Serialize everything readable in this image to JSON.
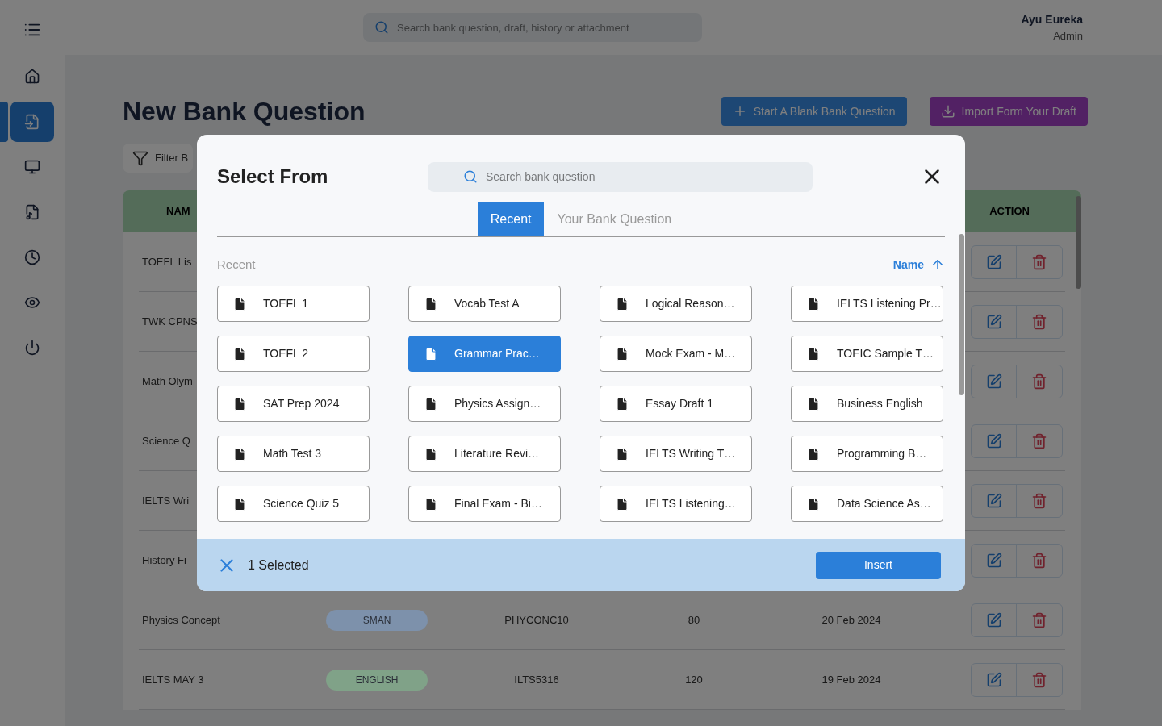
{
  "sidebar": {
    "items": [
      {
        "selected": false
      },
      {
        "selected": true
      },
      {
        "selected": false
      },
      {
        "selected": false
      },
      {
        "selected": false
      },
      {
        "selected": false
      },
      {
        "selected": false
      }
    ]
  },
  "top_bar": {
    "search": {
      "placeholder": "Search bank question, draft, history or attachment"
    },
    "user": {
      "name": "Ayu Eureka",
      "role": "Admin"
    }
  },
  "page": {
    "title": "New Bank Question",
    "buttons": [
      "Start A Blank Bank Question",
      "Import Form Your Draft"
    ],
    "filter": "Filter B",
    "table": {
      "columns": [
        "NAM",
        "ACTION"
      ],
      "rows": [
        {
          "name": "TOEFL Lis"
        },
        {
          "name": "TWK CPNS"
        },
        {
          "name": "Math Olym"
        },
        {
          "name": "Science Q"
        },
        {
          "name": "IELTS Wri"
        },
        {
          "name": "History Fi"
        },
        {
          "name": "Physics Concept",
          "tag": "SMAN",
          "color": "#7d91ab",
          "code": "PHYCONC10",
          "column_4": "80",
          "date": "20 Feb 2024"
        },
        {
          "name": "IELTS MAY 3",
          "tag": "ENGLISH",
          "color": "#80a288",
          "code": "ILTS5316",
          "column_4": "120",
          "date": "19 Feb 2024"
        }
      ]
    }
  },
  "dialog": {
    "title": "Select From",
    "search": {
      "placeholder": "Search bank question"
    },
    "tabs": [
      {
        "label": "Recent",
        "selected": true
      },
      {
        "label": "Your Bank Question",
        "selected": false
      }
    ],
    "section_label": "Recent",
    "sort": {
      "label": "Name"
    },
    "files": [
      {
        "name": "TOEFL 1",
        "selected": false
      },
      {
        "name": "Vocab Test A",
        "selected": false
      },
      {
        "name": "Logical Reason…",
        "selected": false
      },
      {
        "name": "IELTS Listening Pr…",
        "selected": false
      },
      {
        "name": "TOEFL 2",
        "selected": false
      },
      {
        "name": "Grammar Prac…",
        "selected": true
      },
      {
        "name": "Mock Exam - M…",
        "selected": false
      },
      {
        "name": "TOEIC Sample T…",
        "selected": false
      },
      {
        "name": "SAT Prep 2024",
        "selected": false
      },
      {
        "name": "Physics Assign…",
        "selected": false
      },
      {
        "name": "Essay Draft 1",
        "selected": false
      },
      {
        "name": "Business English",
        "selected": false
      },
      {
        "name": "Math Test 3",
        "selected": false
      },
      {
        "name": "Literature Revi…",
        "selected": false
      },
      {
        "name": "IELTS Writing T…",
        "selected": false
      },
      {
        "name": "Programming B…",
        "selected": false
      },
      {
        "name": "Science Quiz 5",
        "selected": false
      },
      {
        "name": "Final Exam - Bi…",
        "selected": false
      },
      {
        "name": "IELTS Listening…",
        "selected": false
      },
      {
        "name": "Data Science As…",
        "selected": false
      }
    ],
    "footer": {
      "count": "1 Selected",
      "button": "Insert"
    }
  }
}
